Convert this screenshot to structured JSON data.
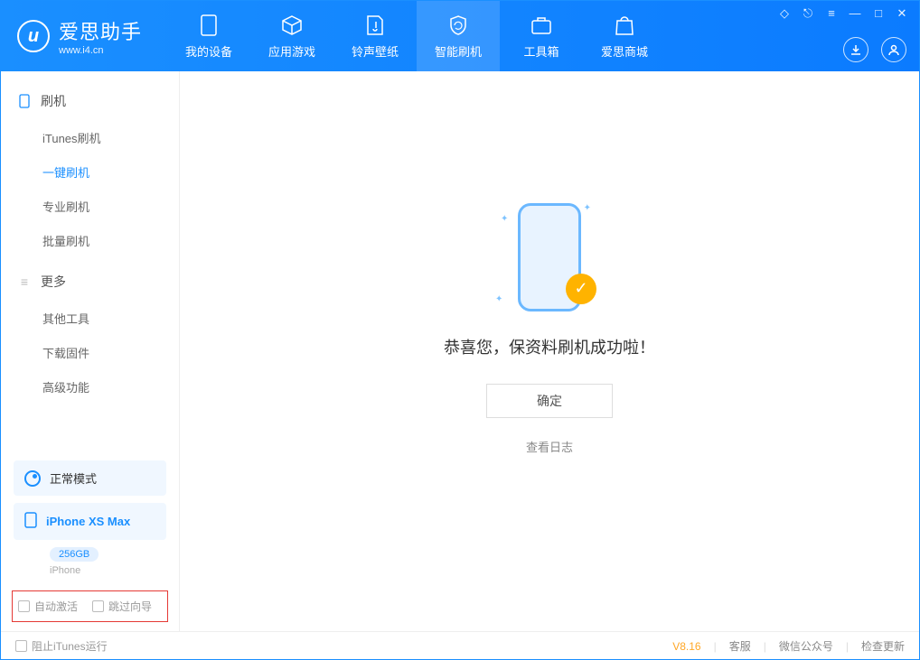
{
  "app": {
    "name": "爱思助手",
    "url": "www.i4.cn"
  },
  "tabs": [
    {
      "label": "我的设备"
    },
    {
      "label": "应用游戏"
    },
    {
      "label": "铃声壁纸"
    },
    {
      "label": "智能刷机"
    },
    {
      "label": "工具箱"
    },
    {
      "label": "爱思商城"
    }
  ],
  "sidebar": {
    "group1": "刷机",
    "items1": [
      "iTunes刷机",
      "一键刷机",
      "专业刷机",
      "批量刷机"
    ],
    "group2": "更多",
    "items2": [
      "其他工具",
      "下载固件",
      "高级功能"
    ]
  },
  "device": {
    "mode": "正常模式",
    "name": "iPhone XS Max",
    "storage": "256GB",
    "type": "iPhone"
  },
  "options": {
    "auto_activate": "自动激活",
    "skip_guide": "跳过向导"
  },
  "main": {
    "success": "恭喜您，保资料刷机成功啦！",
    "ok": "确定",
    "view_log": "查看日志"
  },
  "footer": {
    "block_itunes": "阻止iTunes运行",
    "version": "V8.16",
    "support": "客服",
    "wechat": "微信公众号",
    "update": "检查更新"
  }
}
